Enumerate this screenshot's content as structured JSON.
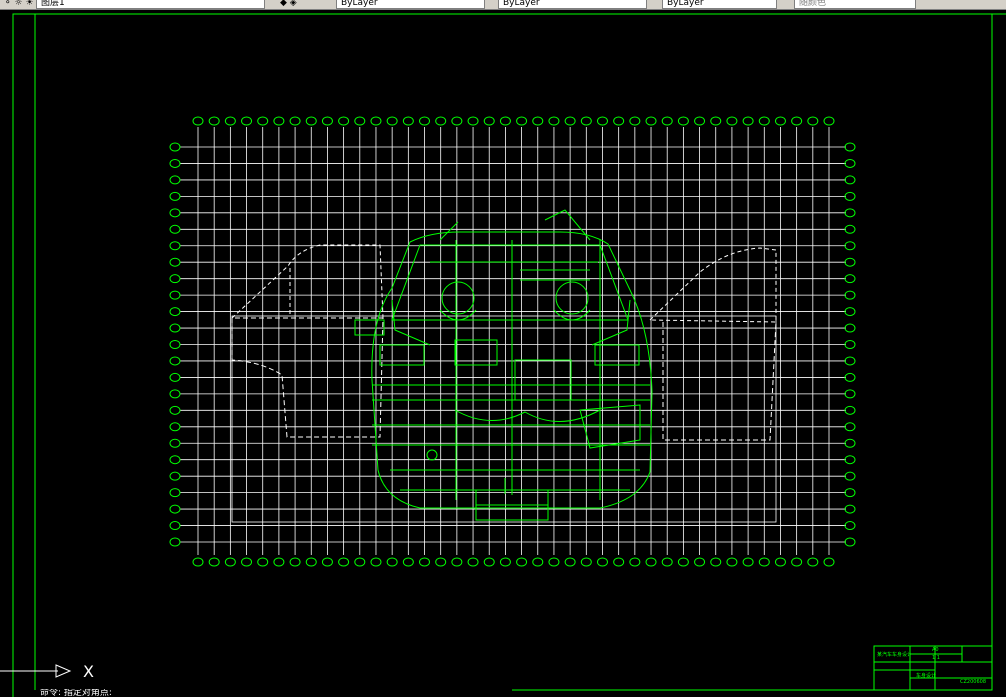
{
  "toolbar": {
    "layer_combo_value": "图层1",
    "linetype_value": "ByLayer",
    "lineweight_value": "ByLayer",
    "plotstyle_value": "ByLayer",
    "color_combo_value": "随颜色"
  },
  "colors": {
    "background": "#000000",
    "drawing_lines": "#00ff00",
    "grid_lines": "#ffffff"
  },
  "ucs_icon": {
    "axis_label": "X"
  },
  "title_block": {
    "cell_top_left": "某汽车车身设计",
    "cell_size": "A0",
    "cell_sheet": "1 1",
    "cell_design": "车身设计",
    "cell_drawing_no": "CZ200608"
  },
  "command_line": {
    "text": "命令: 指定对角点:"
  }
}
